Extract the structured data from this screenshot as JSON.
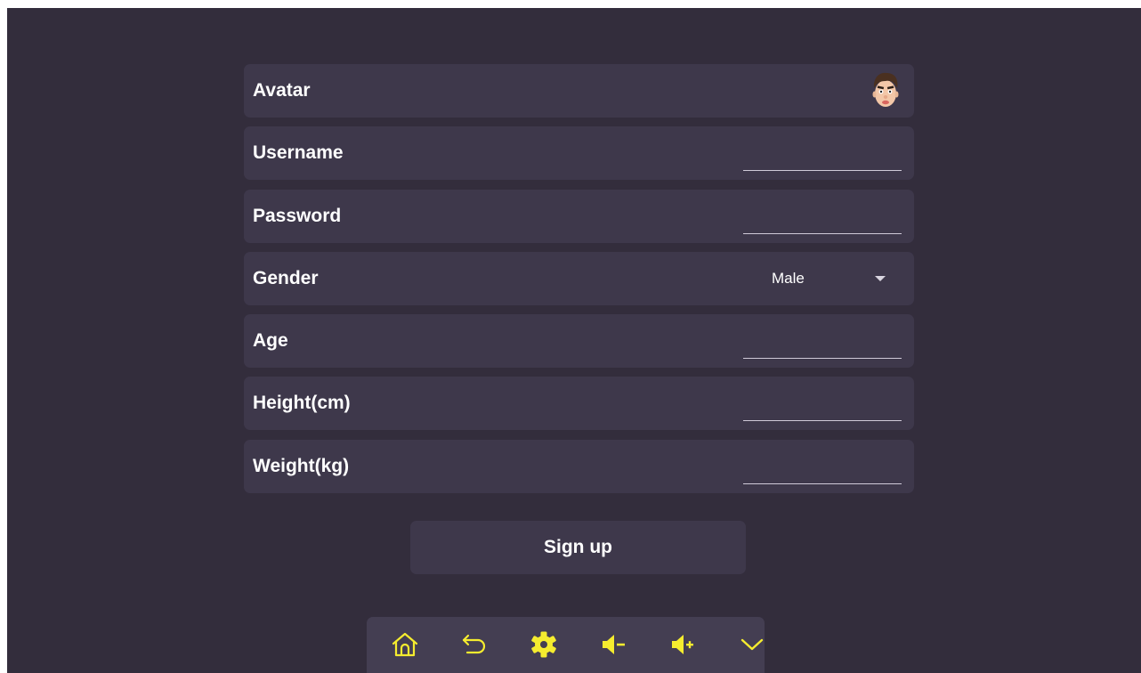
{
  "form": {
    "avatar_label": "Avatar",
    "username": {
      "label": "Username",
      "value": ""
    },
    "password": {
      "label": "Password",
      "value": ""
    },
    "gender": {
      "label": "Gender",
      "selected": "Male"
    },
    "age": {
      "label": "Age",
      "value": ""
    },
    "height": {
      "label": "Height(cm)",
      "value": ""
    },
    "weight": {
      "label": "Weight(kg)",
      "value": ""
    }
  },
  "signup_label": "Sign up",
  "navbar": {
    "buttons": [
      "home-icon",
      "back-icon",
      "gear-icon",
      "volume-down-icon",
      "volume-up-icon",
      "chevron-down-icon"
    ]
  },
  "colors": {
    "background": "#332d3c",
    "card": "#3e384b",
    "navbar": "#443e52",
    "accent": "#f5ec2f",
    "text": "#ffffff"
  }
}
